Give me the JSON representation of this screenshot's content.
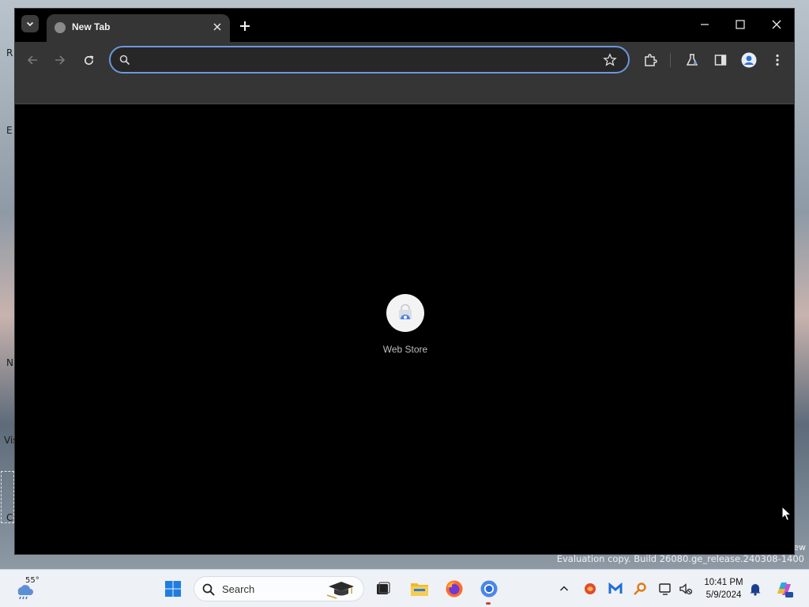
{
  "desktop": {
    "edge_letters": [
      "R",
      "E",
      "N",
      "Vis",
      "C"
    ],
    "right_edge_text": "ew",
    "evaluation_text": "Evaluation copy. Build 26080.ge_release.240308-1400"
  },
  "browser": {
    "tab": {
      "title": "New Tab",
      "favicon": "globe-icon"
    },
    "omnibox": {
      "value": "",
      "placeholder": ""
    },
    "toolbar_icons": [
      "back-arrow-icon",
      "forward-arrow-icon",
      "reload-icon",
      "star-icon",
      "extensions-icon",
      "labs-flask-icon",
      "side-panel-icon",
      "profile-icon",
      "menu-kebab-icon"
    ],
    "shortcuts": [
      {
        "label": "Web Store",
        "icon": "web-store-icon"
      }
    ]
  },
  "taskbar": {
    "weather": {
      "temp": "55°"
    },
    "search_label": "Search",
    "apps": [
      "start-icon",
      "task-view-icon",
      "file-explorer-icon",
      "firefox-icon",
      "chrome-icon"
    ],
    "tray": [
      "chevron-up-icon",
      "app-tray-icon",
      "malwarebytes-icon",
      "key-icon",
      "display-icon",
      "speaker-mute-icon",
      "bell-icon",
      "copilot-icon"
    ],
    "clock": {
      "time": "10:41 PM",
      "date": "5/9/2024"
    }
  },
  "colors": {
    "accent": "#6e97de",
    "titlebar": "#000000",
    "toolbar": "#353535",
    "content_bg": "#000000",
    "taskbar": "#eef1f5"
  }
}
